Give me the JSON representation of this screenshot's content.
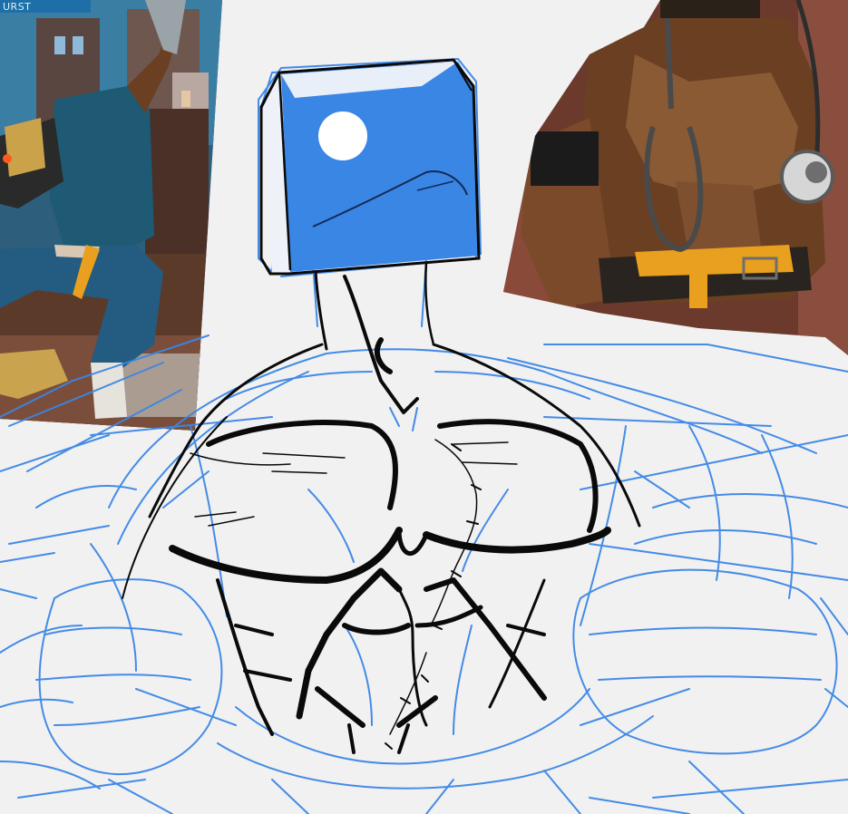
{
  "reference_left": {
    "hud_label": "URST"
  },
  "colors": {
    "paper": "#f1f1f2",
    "sketch_blue": "#3b86e6",
    "ink": "#0a0a0a",
    "head_fill": "#3a86e4",
    "ref_sky": "#1e5a7a",
    "ref_character_teal": "#1f5a74",
    "ref_skin": "#6b3f22",
    "ref_belt": "#e8a01e"
  },
  "icons": {
    "hud": "game-hud-bar-icon"
  }
}
